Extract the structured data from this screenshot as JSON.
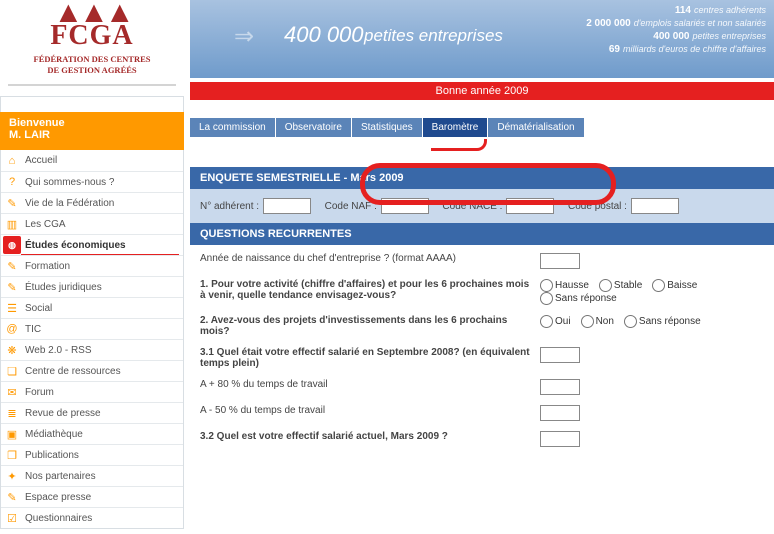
{
  "logo": {
    "main": "FCGA",
    "line1": "FÉDÉRATION DES CENTRES",
    "line2": "DE GESTION AGRÉÉS"
  },
  "welcome": {
    "greeting": "Bienvenue",
    "user": "M. LAIR"
  },
  "nav": [
    {
      "label": "Accueil",
      "icon": "⌂"
    },
    {
      "label": "Qui sommes-nous ?",
      "icon": "?"
    },
    {
      "label": "Vie de la Fédération",
      "icon": "✎"
    },
    {
      "label": "Les CGA",
      "icon": "▥"
    },
    {
      "label": "Études économiques",
      "icon": "◍",
      "active": true
    },
    {
      "label": "Formation",
      "icon": "✎"
    },
    {
      "label": "Études juridiques",
      "icon": "✎"
    },
    {
      "label": "Social",
      "icon": "☰"
    },
    {
      "label": "TIC",
      "icon": "@"
    },
    {
      "label": "Web 2.0 - RSS",
      "icon": "❋"
    },
    {
      "label": "Centre de ressources",
      "icon": "❏"
    },
    {
      "label": "Forum",
      "icon": "✉"
    },
    {
      "label": "Revue de presse",
      "icon": "≣"
    },
    {
      "label": "Médiathèque",
      "icon": "▣"
    },
    {
      "label": "Publications",
      "icon": "❐"
    },
    {
      "label": "Nos partenaires",
      "icon": "✦"
    },
    {
      "label": "Espace presse",
      "icon": "✎"
    },
    {
      "label": "Questionnaires",
      "icon": "☑"
    }
  ],
  "banner": {
    "big_num": "400 000",
    "big_txt": "petites entreprises",
    "stats": [
      {
        "n": "114",
        "t": "centres adhérents"
      },
      {
        "n": "2 000 000",
        "t": "d'emplois salariés et non salariés"
      },
      {
        "n": "400 000",
        "t": "petites entreprises"
      },
      {
        "n": "69",
        "t": "milliards d'euros de chiffre d'affaires"
      }
    ]
  },
  "redbar": "Bonne année 2009",
  "tabs": [
    {
      "label": "La commission"
    },
    {
      "label": "Observatoire"
    },
    {
      "label": "Statistiques"
    },
    {
      "label": "Baromètre",
      "active": true
    },
    {
      "label": "Dématérialisation"
    }
  ],
  "form": {
    "head1a": "ENQUETE SEMESTRIELLE - Mars 2009",
    "adherent_lbl": "N° adhérent :",
    "naf_lbl": "Code NAF :",
    "nace_lbl": "Code NACE :",
    "postal_lbl": "Code postal :",
    "head2": "QUESTIONS RECURRENTES",
    "q_birth": "Année de naissance du chef d'entreprise ? (format AAAA)",
    "q1": "1. Pour votre activité (chiffre d'affaires) et pour les 6 prochaines mois à venir, quelle tendance envisagez-vous?",
    "q1_opts": [
      "Hausse",
      "Stable",
      "Baisse",
      "Sans réponse"
    ],
    "q2": "2. Avez-vous des projets d'investissements dans les 6 prochains mois?",
    "q2_opts": [
      "Oui",
      "Non",
      "Sans réponse"
    ],
    "q31": "3.1 Quel était votre effectif salarié en Septembre 2008? (en équivalent temps plein)",
    "q31a": "A + 80 % du temps de travail",
    "q31b": "A - 50 % du temps de travail",
    "q32": "3.2 Quel est votre effectif salarié actuel, Mars 2009 ?"
  }
}
